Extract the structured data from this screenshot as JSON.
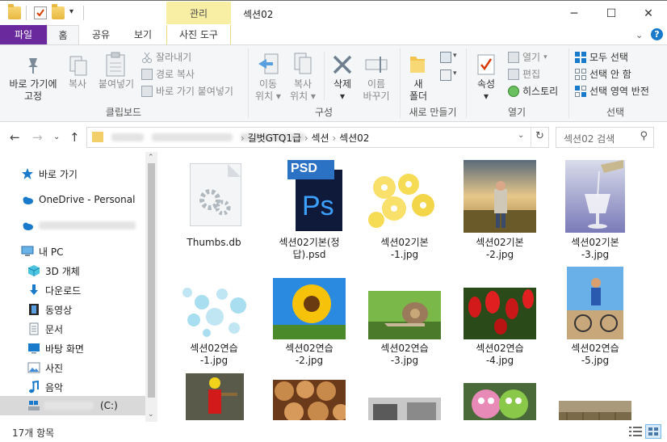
{
  "window": {
    "title": "섹션02",
    "context_tab_header": "관리",
    "controls": {
      "minimize": "─",
      "maximize": "☐",
      "close": "✕"
    }
  },
  "tabs": {
    "file": "파일",
    "home": "홈",
    "share": "공유",
    "view": "보기",
    "picture_tools": "사진 도구"
  },
  "ribbon": {
    "clipboard": {
      "pin_label": "바로 가기에\n고정",
      "copy_label": "복사",
      "paste_label": "붙여넣기",
      "cut": "잘라내기",
      "copy_path": "경로 복사",
      "paste_shortcut": "바로 가기 붙여넣기",
      "group": "클립보드"
    },
    "organize": {
      "move_label": "이동\n위치",
      "copy_to_label": "복사\n위치",
      "delete_label": "삭제",
      "rename_label": "이름\n바꾸기",
      "group": "구성"
    },
    "new": {
      "new_folder_label": "새\n폴더",
      "group": "새로 만들기"
    },
    "open": {
      "properties_label": "속성",
      "open": "열기",
      "edit": "편집",
      "history": "히스토리",
      "group": "열기"
    },
    "select": {
      "select_all": "모두 선택",
      "select_none": "선택 안 함",
      "invert": "선택 영역 반전",
      "group": "선택"
    }
  },
  "address": {
    "crumbs": [
      "길벗GTQ1급",
      "섹션",
      "섹션02"
    ],
    "search_placeholder": "섹션02 검색"
  },
  "nav": {
    "quick_access": "바로 가기",
    "onedrive": "OneDrive - Personal",
    "this_pc": "내 PC",
    "objects_3d": "3D 개체",
    "downloads": "다운로드",
    "videos": "동영상",
    "documents": "문서",
    "desktop": "바탕 화면",
    "pictures": "사진",
    "music": "음악",
    "drive_c": "(C:)"
  },
  "files": [
    {
      "name": "Thumbs.db"
    },
    {
      "name": "섹션02기본(정\n답).psd",
      "badge": "PSD",
      "ps": "Ps"
    },
    {
      "name": "섹션02기본\n-1.jpg"
    },
    {
      "name": "섹션02기본\n-2.jpg"
    },
    {
      "name": "섹션02기본\n-3.jpg"
    },
    {
      "name": "섹션02연습\n-1.jpg"
    },
    {
      "name": "섹션02연습\n-2.jpg"
    },
    {
      "name": "섹션02연습\n-3.jpg"
    },
    {
      "name": "섹션02연습\n-4.jpg"
    },
    {
      "name": "섹션02연습\n-5.jpg"
    },
    {
      "name": ""
    },
    {
      "name": ""
    },
    {
      "name": ""
    },
    {
      "name": ""
    },
    {
      "name": ""
    }
  ],
  "status": {
    "count": "17개 항목"
  },
  "colors": {
    "file_tab": "#6a2a9e",
    "manage_tab": "#f8eea4",
    "accent_blue": "#1979ca"
  }
}
